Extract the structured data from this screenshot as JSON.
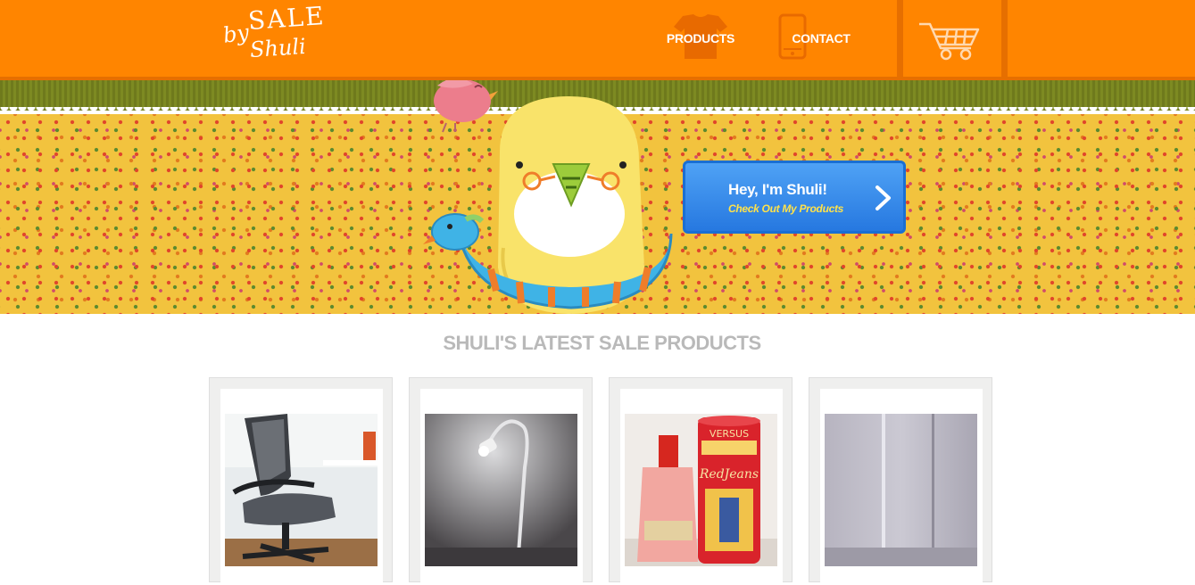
{
  "header": {
    "logo": {
      "by": "by",
      "sale": "SALE",
      "shuli": "Shuli"
    },
    "nav": [
      {
        "label": "PRODUCTS",
        "icon": "tshirt-icon"
      },
      {
        "label": "CONTACT",
        "icon": "phone-icon"
      }
    ],
    "cart_icon": "shopping-cart-icon"
  },
  "banner": {
    "cta": {
      "title": "Hey, I'm Shuli!",
      "subtitle": "Check Out My Products",
      "icon": "chevron-right-icon"
    },
    "mascot": "yellow-chick-with-float-ring",
    "bird": "pink-bird"
  },
  "products": {
    "title": "SHULI'S LATEST SALE PRODUCTS",
    "items": [
      {
        "image": "office-chair-photo"
      },
      {
        "image": "desk-lamp-photo"
      },
      {
        "image": "versus-red-jeans-perfume-photo"
      },
      {
        "image": "wall-closet-photo"
      }
    ]
  },
  "colors": {
    "header_orange": "#ff8500",
    "cta_blue": "#2678e0",
    "cta_subtitle_yellow": "#ffe24a",
    "title_gray": "#b9b9b9"
  }
}
